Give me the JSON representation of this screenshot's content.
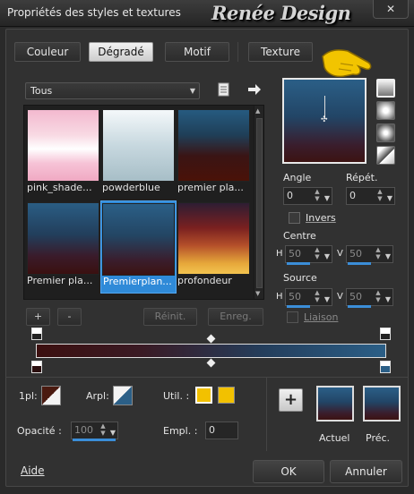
{
  "window": {
    "title": "Propriétés des styles et textures",
    "watermark": "Renée Design",
    "close": "✕"
  },
  "tabs": [
    {
      "label": "Couleur",
      "active": false
    },
    {
      "label": "Dégradé",
      "active": true
    },
    {
      "label": "Motif",
      "active": false
    },
    {
      "label": "Texture",
      "active": false
    }
  ],
  "category": {
    "selected": "Tous"
  },
  "gradients": [
    {
      "label": "pink_shade...",
      "css": "linear-gradient(#f3b9cf 0%,#f8d9e3 35%,#ffffff 55%,#f6c3d6 75%,#f0a9c3 100%)"
    },
    {
      "label": "powderblue",
      "css": "linear-gradient(#f4f8fa 0%,#c7d8df 50%,#a7bec7 100%)"
    },
    {
      "label": "premier pla...",
      "css": "linear-gradient(#265b80 0%,#1f3f58 35%,#3a1414 65%,#4a1208 100%)"
    },
    {
      "label": "Premier pla...",
      "css": "linear-gradient(#2a5d84 0%,#223e5b 45%,#3a1b2a 75%,#3a1010 100%)"
    },
    {
      "label": "Premierplan...",
      "css": "linear-gradient(#2b5f87 0%,#234563 45%,#3a1d2c 80%,#3c1312 100%)",
      "selected": true
    },
    {
      "label": "profondeur",
      "css": "linear-gradient(#2e1d33 0%,#7a2020 35%,#b5502a 60%,#e6a73a 85%,#f3c44f 100%)"
    }
  ],
  "list_buttons": {
    "add": "+",
    "remove": "-",
    "reinit": "Réinit.",
    "save": "Enreg."
  },
  "preview": {
    "css": "linear-gradient(#2b5f87 0%,#224566 45%,#3a1d2c 80%,#3c1312 100%)"
  },
  "angle": {
    "label": "Angle",
    "value": "0"
  },
  "repeat": {
    "label": "Répét.",
    "value": "0"
  },
  "invert": {
    "label": "Invers"
  },
  "center": {
    "label": "Centre",
    "h_label": "H",
    "h_value": "50",
    "v_label": "V",
    "v_value": "50"
  },
  "source": {
    "label": "Source",
    "h_label": "H",
    "h_value": "50",
    "v_label": "V",
    "v_value": "50"
  },
  "link": {
    "label": "Liaison"
  },
  "bar_gradient": "linear-gradient(90deg,#3c1010 0%,#3a1a24 30%,#243e5c 65%,#2b5f87 100%)",
  "bottom": {
    "first_plan": "1pl:",
    "arplan": "Arpl:",
    "util": "Util. :",
    "opacity_label": "Opacité :",
    "opacity_value": "100",
    "empl_label": "Empl. :",
    "empl_value": "0",
    "current": "Actuel",
    "previous": "Préc."
  },
  "footer": {
    "help": "Aide",
    "ok": "OK",
    "cancel": "Annuler"
  },
  "colors": {
    "accent": "#3b8ed8",
    "util_swatch": "#f2c100"
  }
}
